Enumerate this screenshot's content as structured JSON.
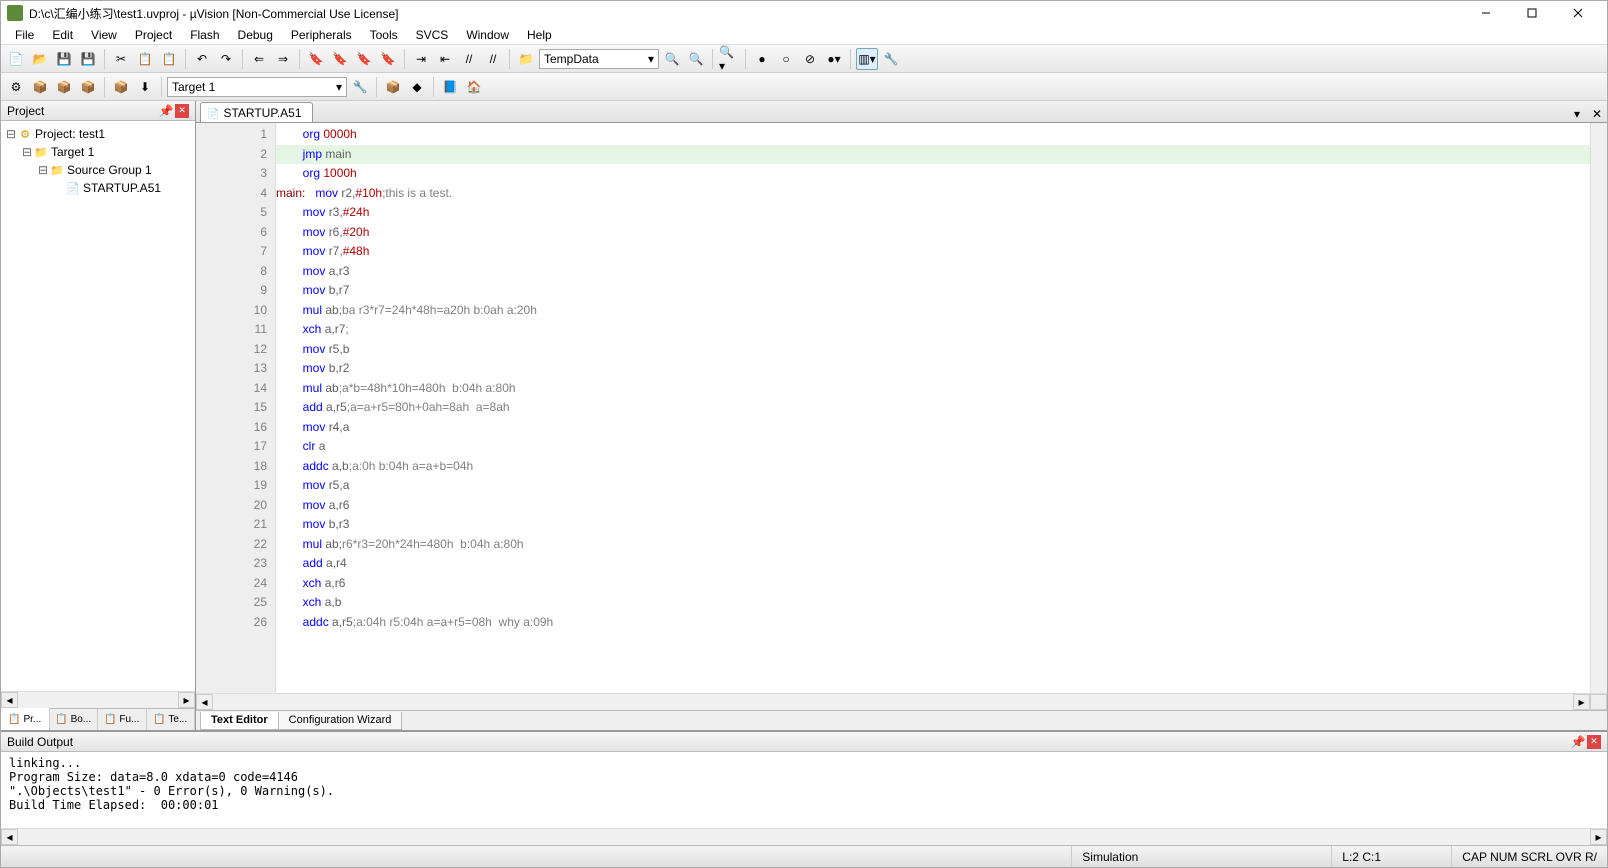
{
  "title": "D:\\c\\汇编小练习\\test1.uvproj - µVision  [Non-Commercial Use License]",
  "menu": [
    "File",
    "Edit",
    "View",
    "Project",
    "Flash",
    "Debug",
    "Peripherals",
    "Tools",
    "SVCS",
    "Window",
    "Help"
  ],
  "toolbar2": {
    "target": "Target 1",
    "combo": "TempData"
  },
  "project_panel": {
    "title": "Project",
    "tree": {
      "root": "Project: test1",
      "target": "Target 1",
      "group": "Source Group 1",
      "file": "STARTUP.A51"
    },
    "tabs": [
      "Pr...",
      "Bo...",
      "Fu...",
      "Te..."
    ]
  },
  "editor": {
    "tab": "STARTUP.A51",
    "current_line": 2,
    "lines": [
      {
        "n": 1,
        "i": "        ",
        "op": "org",
        "arg": "0000h",
        "argcls": "num"
      },
      {
        "n": 2,
        "i": "        ",
        "op": "jmp",
        "arg": "main",
        "argcls": "reg"
      },
      {
        "n": 3,
        "i": "        ",
        "op": "org",
        "arg": "1000h",
        "argcls": "num"
      },
      {
        "n": 4,
        "lbl": "main:",
        "i": "   ",
        "op": "mov",
        "arg": "r2,",
        "imm": "#10h",
        "com": ";this is a test."
      },
      {
        "n": 5,
        "i": "        ",
        "op": "mov",
        "arg": "r3,",
        "imm": "#24h"
      },
      {
        "n": 6,
        "i": "        ",
        "op": "mov",
        "arg": "r6,",
        "imm": "#20h"
      },
      {
        "n": 7,
        "i": "        ",
        "op": "mov",
        "arg": "r7,",
        "imm": "#48h"
      },
      {
        "n": 8,
        "i": "        ",
        "op": "mov",
        "arg": "a,r3",
        "argcls": "reg"
      },
      {
        "n": 9,
        "i": "        ",
        "op": "mov",
        "arg": "b,r7",
        "argcls": "reg"
      },
      {
        "n": 10,
        "i": "        ",
        "op": "mul",
        "arg": "ab",
        "argcls": "reg",
        "com": ";ba r3*r7=24h*48h=a20h b:0ah a:20h"
      },
      {
        "n": 11,
        "i": "        ",
        "op": "xch",
        "arg": "a,r7",
        "argcls": "reg",
        "com": ";"
      },
      {
        "n": 12,
        "i": "        ",
        "op": "mov",
        "arg": "r5,b",
        "argcls": "reg"
      },
      {
        "n": 13,
        "i": "        ",
        "op": "mov",
        "arg": "b,r2",
        "argcls": "reg"
      },
      {
        "n": 14,
        "i": "        ",
        "op": "mul",
        "arg": "ab",
        "argcls": "reg",
        "com": ";a*b=48h*10h=480h  b:04h a:80h"
      },
      {
        "n": 15,
        "i": "        ",
        "op": "add",
        "arg": "a,r5",
        "argcls": "reg",
        "com": ";a=a+r5=80h+0ah=8ah  a=8ah"
      },
      {
        "n": 16,
        "i": "        ",
        "op": "mov",
        "arg": "r4,a",
        "argcls": "reg"
      },
      {
        "n": 17,
        "i": "        ",
        "op": "clr",
        "arg": "a",
        "argcls": "reg"
      },
      {
        "n": 18,
        "i": "        ",
        "op": "addc",
        "arg": "a,b",
        "argcls": "reg",
        "com": ";a:0h b:04h a=a+b=04h"
      },
      {
        "n": 19,
        "i": "        ",
        "op": "mov",
        "arg": "r5,a",
        "argcls": "reg"
      },
      {
        "n": 20,
        "i": "        ",
        "op": "mov",
        "arg": "a,r6",
        "argcls": "reg"
      },
      {
        "n": 21,
        "i": "        ",
        "op": "mov",
        "arg": "b,r3",
        "argcls": "reg"
      },
      {
        "n": 22,
        "i": "        ",
        "op": "mul",
        "arg": "ab",
        "argcls": "reg",
        "com": ";r6*r3=20h*24h=480h  b:04h a:80h"
      },
      {
        "n": 23,
        "i": "        ",
        "op": "add",
        "arg": "a,r4",
        "argcls": "reg"
      },
      {
        "n": 24,
        "i": "        ",
        "op": "xch",
        "arg": "a,r6",
        "argcls": "reg"
      },
      {
        "n": 25,
        "i": "        ",
        "op": "xch",
        "arg": "a,b",
        "argcls": "reg"
      },
      {
        "n": 26,
        "i": "        ",
        "op": "addc",
        "arg": "a,r5",
        "argcls": "reg",
        "com": ";a:04h r5:04h a=a+r5=08h  why a:09h"
      }
    ],
    "bottom_tabs": [
      "Text Editor",
      "Configuration Wizard"
    ]
  },
  "build": {
    "title": "Build Output",
    "lines": [
      "linking...",
      "Program Size: data=8.0 xdata=0 code=4146",
      "\".\\Objects\\test1\" - 0 Error(s), 0 Warning(s).",
      "Build Time Elapsed:  00:00:01"
    ]
  },
  "status": {
    "mode": "Simulation",
    "pos": "L:2 C:1",
    "flags": [
      "CAP",
      "NUM",
      "SCRL",
      "OVR",
      "R/"
    ]
  }
}
